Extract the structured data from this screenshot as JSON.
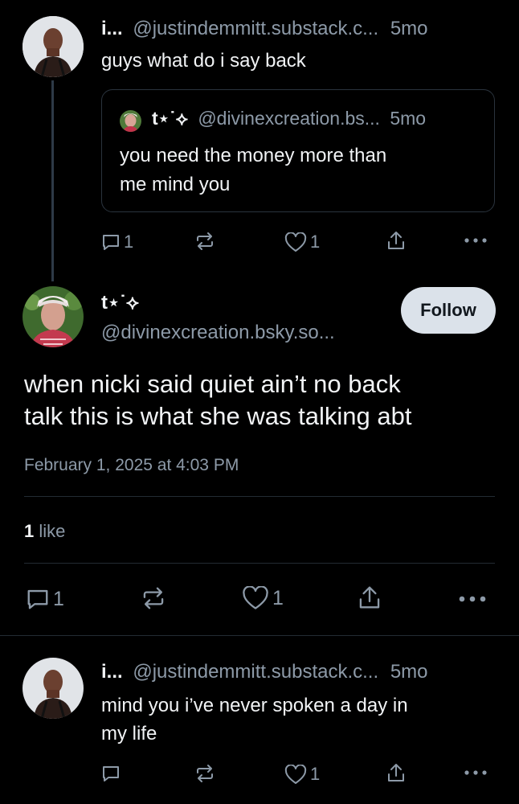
{
  "post1": {
    "display_name": "i...",
    "handle": "@justindemmitt.substack.c...",
    "time": "5mo",
    "text": "guys what do i say back",
    "quote": {
      "display_name": "t⋆˙⟡",
      "handle": "@divinexcreation.bs...",
      "time": "5mo",
      "text_line1": "you need the money more than",
      "text_line2": "me mind you"
    },
    "reply_count": "1",
    "like_count": "1"
  },
  "main_post": {
    "display_name": "t⋆˙⟡",
    "handle": "@divinexcreation.bsky.so...",
    "follow_label": "Follow",
    "text_line1": "when nicki said quiet ain’t no back",
    "text_line2": "talk this is what she was talking abt",
    "timestamp": "February 1, 2025 at 4:03 PM",
    "likes_number": "1",
    "likes_label": "like",
    "reply_count": "1",
    "like_count": "1"
  },
  "reply": {
    "display_name": "i...",
    "handle": "@justindemmitt.substack.c...",
    "time": "5mo",
    "text_line1": "mind you i’ve never spoken a day in",
    "text_line2": "my life",
    "like_count": "1"
  },
  "colors": {
    "background": "#000000",
    "text": "#f1f3f5",
    "muted": "#8d9aa8",
    "follow_bg": "#dbe2ea"
  }
}
